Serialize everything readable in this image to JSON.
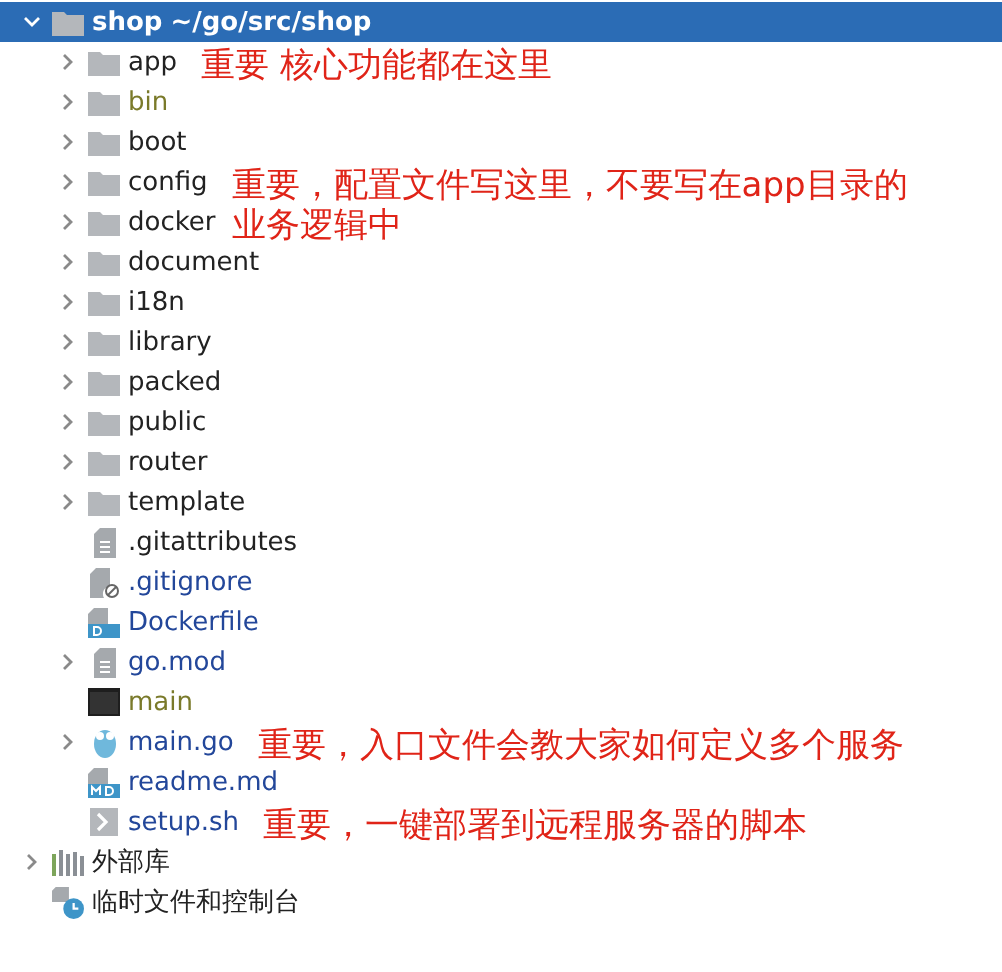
{
  "root": {
    "name": "shop",
    "path": "~/go/src/shop",
    "selected": true,
    "expanded": true,
    "children": [
      {
        "name": "app",
        "kind": "folder",
        "expanded": false,
        "color": "#222222",
        "note": "重要 核心功能都在这里"
      },
      {
        "name": "bin",
        "kind": "folder",
        "expanded": false,
        "color": "#7a7a2a"
      },
      {
        "name": "boot",
        "kind": "folder",
        "expanded": false,
        "color": "#222222"
      },
      {
        "name": "config",
        "kind": "folder",
        "expanded": false,
        "color": "#222222",
        "note": "重要，配置文件写这里，不要写在app目录的业务逻辑中"
      },
      {
        "name": "docker",
        "kind": "folder",
        "expanded": false,
        "color": "#222222"
      },
      {
        "name": "document",
        "kind": "folder",
        "expanded": false,
        "color": "#222222"
      },
      {
        "name": "i18n",
        "kind": "folder",
        "expanded": false,
        "color": "#222222"
      },
      {
        "name": "library",
        "kind": "folder",
        "expanded": false,
        "color": "#222222"
      },
      {
        "name": "packed",
        "kind": "folder",
        "expanded": false,
        "color": "#222222"
      },
      {
        "name": "public",
        "kind": "folder",
        "expanded": false,
        "color": "#222222"
      },
      {
        "name": "router",
        "kind": "folder",
        "expanded": false,
        "color": "#222222"
      },
      {
        "name": "template",
        "kind": "folder",
        "expanded": false,
        "color": "#222222"
      },
      {
        "name": ".gitattributes",
        "kind": "text",
        "color": "#222222"
      },
      {
        "name": ".gitignore",
        "kind": "ignore",
        "color": "#23479a"
      },
      {
        "name": "Dockerfile",
        "kind": "docker",
        "color": "#23479a"
      },
      {
        "name": "go.mod",
        "kind": "text",
        "expanded": false,
        "color": "#23479a"
      },
      {
        "name": "main",
        "kind": "binary",
        "color": "#7a7a2a"
      },
      {
        "name": "main.go",
        "kind": "go",
        "expanded": false,
        "color": "#23479a",
        "note": "重要，入口文件会教大家如何定义多个服务"
      },
      {
        "name": "readme.md",
        "kind": "markdown",
        "color": "#23479a"
      },
      {
        "name": "setup.sh",
        "kind": "shell",
        "color": "#23479a",
        "note": "重要，一键部署到远程服务器的脚本"
      }
    ]
  },
  "extra": [
    {
      "name": "外部库",
      "kind": "libraries",
      "expanded": false
    },
    {
      "name": "临时文件和控制台",
      "kind": "scratches"
    }
  ]
}
